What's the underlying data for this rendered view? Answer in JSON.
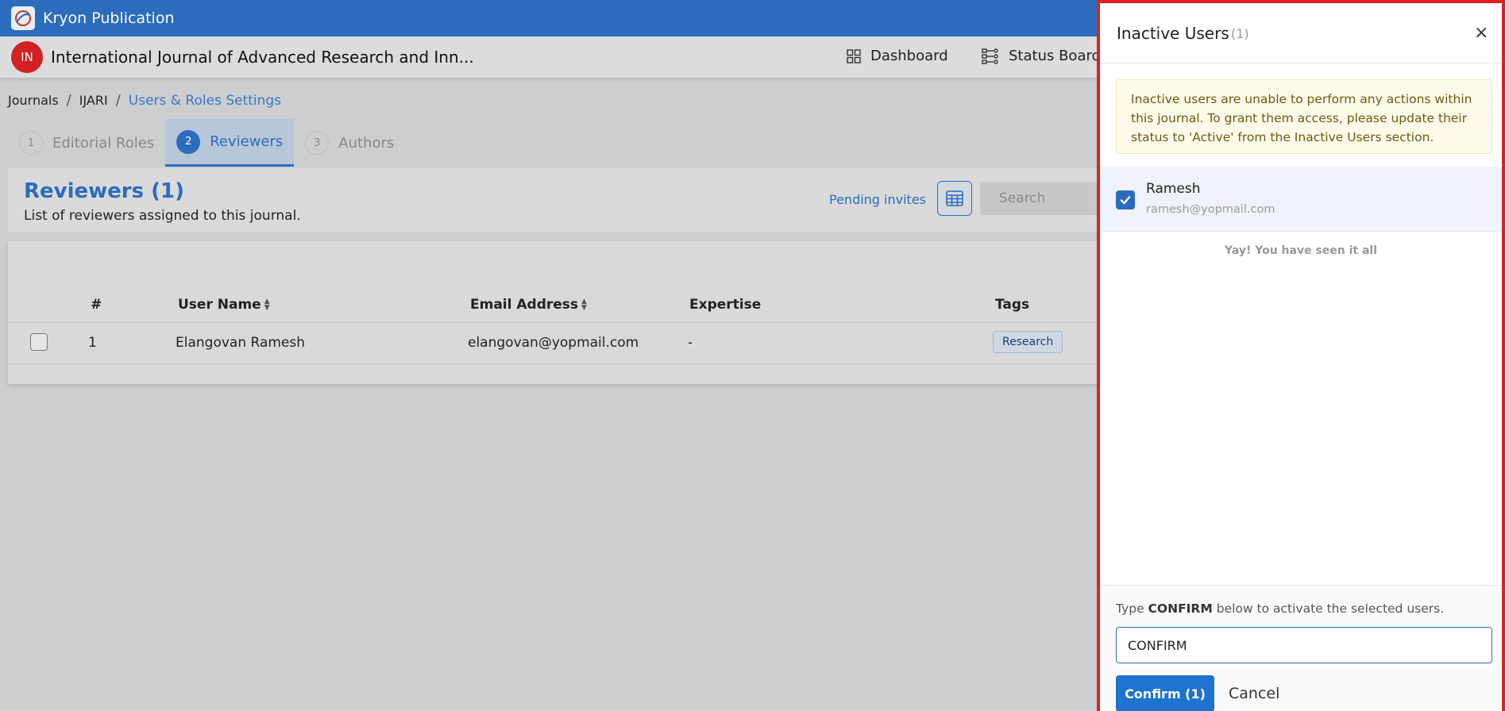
{
  "app": {
    "title": "Kryon Publication"
  },
  "journal": {
    "avatar": "IN",
    "title": "International Journal of Advanced Research and Inn..."
  },
  "nav": {
    "dashboard": "Dashboard",
    "status_board": "Status Board"
  },
  "breadcrumb": {
    "journals": "Journals",
    "ijari": "IJARI",
    "current": "Users & Roles Settings"
  },
  "tabs": [
    {
      "num": "1",
      "label": "Editorial Roles"
    },
    {
      "num": "2",
      "label": "Reviewers"
    },
    {
      "num": "3",
      "label": "Authors"
    }
  ],
  "reviewers": {
    "title": "Reviewers (1)",
    "subtitle": "List of reviewers assigned to this journal.",
    "pending_invites": "Pending invites",
    "search_placeholder": "Search"
  },
  "table": {
    "headers": {
      "num": "#",
      "user_name": "User Name",
      "email": "Email Address",
      "expertise": "Expertise",
      "tags": "Tags"
    },
    "rows": [
      {
        "num": "1",
        "user_name": "Elangovan Ramesh",
        "email": "elangovan@yopmail.com",
        "expertise": "-",
        "tag": "Research"
      }
    ]
  },
  "drawer": {
    "title": "Inactive Users",
    "count": "(1)",
    "close": "×",
    "alert": "Inactive users are unable to perform any actions within this journal. To grant them access, please update their status to 'Active' from the Inactive Users section.",
    "users": [
      {
        "name": "Ramesh",
        "email": "ramesh@yopmail.com",
        "checked": true
      }
    ],
    "seen_all": "Yay! You have seen it all",
    "hint_prefix": "Type",
    "hint_keyword": "CONFIRM",
    "hint_suffix": "below to activate the selected users.",
    "input_value": "CONFIRM",
    "confirm_label": "Confirm (1)",
    "cancel_label": "Cancel"
  },
  "colors": {
    "brand": "#2b6cbd",
    "alert_bg": "#fefae9",
    "highlight_border": "#e02020"
  }
}
